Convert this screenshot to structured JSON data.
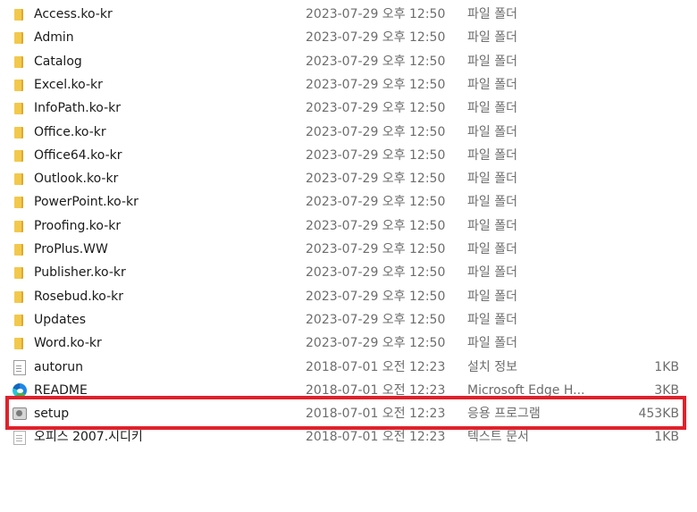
{
  "colors": {
    "highlight": "#e0212b",
    "folder": "#f2c94c"
  },
  "files": [
    {
      "name": "Access.ko-kr",
      "date": "2023-07-29 오후 12:50",
      "type": "파일 폴더",
      "size": "",
      "icon": "folder-icon"
    },
    {
      "name": "Admin",
      "date": "2023-07-29 오후 12:50",
      "type": "파일 폴더",
      "size": "",
      "icon": "folder-icon"
    },
    {
      "name": "Catalog",
      "date": "2023-07-29 오후 12:50",
      "type": "파일 폴더",
      "size": "",
      "icon": "folder-icon"
    },
    {
      "name": "Excel.ko-kr",
      "date": "2023-07-29 오후 12:50",
      "type": "파일 폴더",
      "size": "",
      "icon": "folder-icon"
    },
    {
      "name": "InfoPath.ko-kr",
      "date": "2023-07-29 오후 12:50",
      "type": "파일 폴더",
      "size": "",
      "icon": "folder-icon"
    },
    {
      "name": "Office.ko-kr",
      "date": "2023-07-29 오후 12:50",
      "type": "파일 폴더",
      "size": "",
      "icon": "folder-icon"
    },
    {
      "name": "Office64.ko-kr",
      "date": "2023-07-29 오후 12:50",
      "type": "파일 폴더",
      "size": "",
      "icon": "folder-icon"
    },
    {
      "name": "Outlook.ko-kr",
      "date": "2023-07-29 오후 12:50",
      "type": "파일 폴더",
      "size": "",
      "icon": "folder-icon"
    },
    {
      "name": "PowerPoint.ko-kr",
      "date": "2023-07-29 오후 12:50",
      "type": "파일 폴더",
      "size": "",
      "icon": "folder-icon"
    },
    {
      "name": "Proofing.ko-kr",
      "date": "2023-07-29 오후 12:50",
      "type": "파일 폴더",
      "size": "",
      "icon": "folder-icon"
    },
    {
      "name": "ProPlus.WW",
      "date": "2023-07-29 오후 12:50",
      "type": "파일 폴더",
      "size": "",
      "icon": "folder-icon"
    },
    {
      "name": "Publisher.ko-kr",
      "date": "2023-07-29 오후 12:50",
      "type": "파일 폴더",
      "size": "",
      "icon": "folder-icon"
    },
    {
      "name": "Rosebud.ko-kr",
      "date": "2023-07-29 오후 12:50",
      "type": "파일 폴더",
      "size": "",
      "icon": "folder-icon"
    },
    {
      "name": "Updates",
      "date": "2023-07-29 오후 12:50",
      "type": "파일 폴더",
      "size": "",
      "icon": "folder-icon"
    },
    {
      "name": "Word.ko-kr",
      "date": "2023-07-29 오후 12:50",
      "type": "파일 폴더",
      "size": "",
      "icon": "folder-icon"
    },
    {
      "name": "autorun",
      "date": "2018-07-01 오전 12:23",
      "type": "설치 정보",
      "size": "1KB",
      "icon": "setup-info-icon"
    },
    {
      "name": "README",
      "date": "2018-07-01 오전 12:23",
      "type": "Microsoft Edge H...",
      "size": "3KB",
      "icon": "edge-icon"
    },
    {
      "name": "setup",
      "date": "2018-07-01 오전 12:23",
      "type": "응용 프로그램",
      "size": "453KB",
      "icon": "setup-icon"
    },
    {
      "name": "오피스 2007.시디키",
      "date": "2018-07-01 오전 12:23",
      "type": "텍스트 문서",
      "size": "1KB",
      "icon": "text-file-icon"
    }
  ]
}
